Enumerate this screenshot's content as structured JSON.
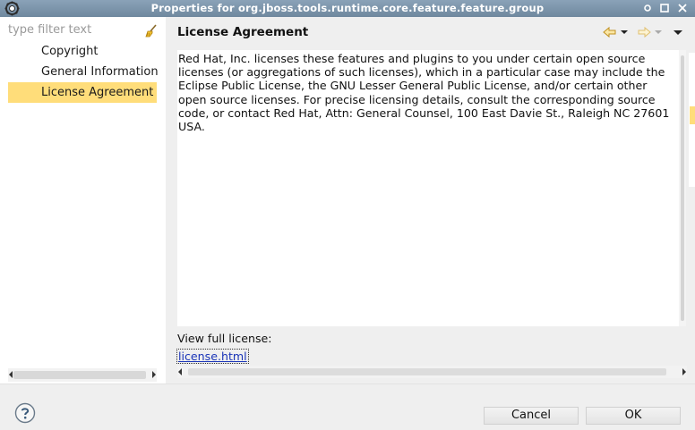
{
  "window": {
    "title": "Properties for org.jboss.tools.runtime.core.feature.feature.group",
    "icons": [
      "eclipse-icon",
      "minimize-icon",
      "maximize-icon",
      "close-icon"
    ]
  },
  "sidebar": {
    "filter_placeholder": "type filter text",
    "items": [
      {
        "label": "Copyright",
        "selected": false
      },
      {
        "label": "General Information",
        "selected": false
      },
      {
        "label": "License Agreement",
        "selected": true
      }
    ]
  },
  "page": {
    "title": "License Agreement",
    "license_text": "Red Hat, Inc. licenses these features and plugins to you under certain open source licenses (or aggregations of such licenses), which in a particular case may include the Eclipse Public License, the GNU Lesser General Public License, and/or certain other open source licenses. For precise licensing details, consult the corresponding source code, or contact Red Hat, Attn: General Counsel, 100 East Davie St., Raleigh NC 27601 USA.",
    "view_full_label": "View full license:",
    "license_link": "license.html"
  },
  "buttons": {
    "cancel": "Cancel",
    "ok": "OK"
  },
  "colors": {
    "selection": "#ffdd7a",
    "titlebar": "#7d96ac",
    "link": "#1a34b8"
  }
}
